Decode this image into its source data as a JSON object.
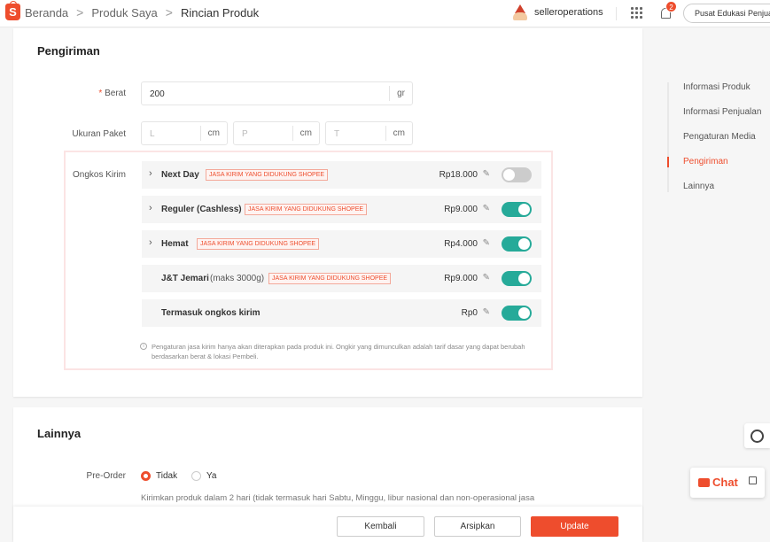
{
  "breadcrumb": {
    "home": "Beranda",
    "section": "Produk Saya",
    "current": "Rincian Produk",
    "separator": ">"
  },
  "header": {
    "username": "selleroperations",
    "notification_count": "2",
    "edu_button": "Pusat Edukasi Penjual"
  },
  "pengiriman": {
    "title": "Pengiriman",
    "weight": {
      "label": "Berat",
      "required_mark": "*",
      "value": "200",
      "unit": "gr"
    },
    "package": {
      "label": "Ukuran Paket",
      "fields": [
        {
          "placeholder": "L",
          "unit": "cm"
        },
        {
          "placeholder": "P",
          "unit": "cm"
        },
        {
          "placeholder": "T",
          "unit": "cm"
        }
      ]
    },
    "shipping": {
      "label": "Ongkos Kirim",
      "rows": [
        {
          "name": "Next Day",
          "extra": "",
          "tag": "JASA KIRIM YANG DIDUKUNG SHOPEE",
          "price": "Rp18.000",
          "enabled": false,
          "expandable": true
        },
        {
          "name": "Reguler (Cashless)",
          "extra": "",
          "tag": "JASA KIRIM YANG DIDUKUNG SHOPEE",
          "price": "Rp9.000",
          "enabled": true,
          "expandable": true
        },
        {
          "name": "Hemat",
          "extra": "",
          "tag": "JASA KIRIM YANG DIDUKUNG SHOPEE",
          "price": "Rp4.000",
          "enabled": true,
          "expandable": true
        },
        {
          "name": "J&T Jemari",
          "extra": "(maks 3000g)",
          "tag": "JASA KIRIM YANG DIDUKUNG SHOPEE",
          "price": "Rp9.000",
          "enabled": true,
          "expandable": false
        },
        {
          "name": "Termasuk ongkos kirim",
          "extra": "",
          "tag": "",
          "price": "Rp0",
          "enabled": true,
          "expandable": false
        }
      ],
      "note": "Pengaturan jasa kirim hanya akan diterapkan pada produk ini. Ongkir yang dimunculkan adalah tarif dasar yang dapat berubah berdasarkan berat & lokasi Pembeli."
    }
  },
  "sidenav": {
    "items": [
      "Informasi Produk",
      "Informasi Penjualan",
      "Pengaturan Media",
      "Pengiriman",
      "Lainnya"
    ],
    "active": "Pengiriman"
  },
  "lainnya": {
    "title": "Lainnya",
    "preorder": {
      "label": "Pre-Order",
      "options": [
        "Tidak",
        "Ya"
      ],
      "selected": "Tidak",
      "note": "Kirimkan produk dalam 2 hari (tidak termasuk hari Sabtu, Minggu, libur nasional dan non-operasional jasa"
    }
  },
  "actions": {
    "back": "Kembali",
    "archive": "Arsipkan",
    "update": "Update"
  },
  "chat": {
    "label": "Chat"
  },
  "colors": {
    "brand": "#ee4d2d",
    "toggle_on": "#26aa99",
    "toggle_off": "#cccccc"
  }
}
